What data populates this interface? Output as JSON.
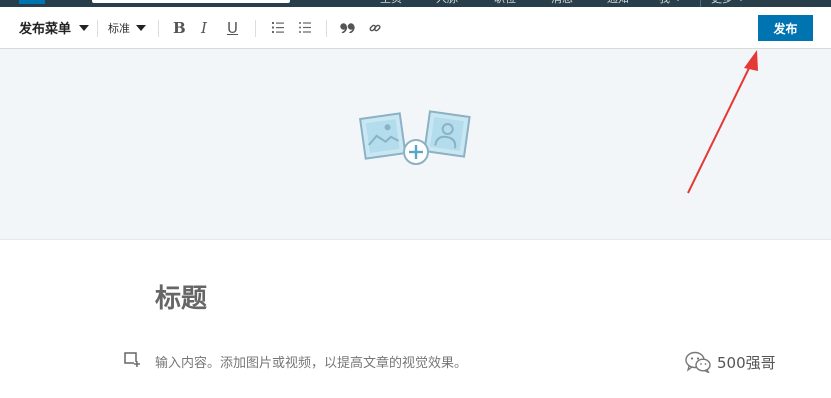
{
  "topnav": {
    "items": [
      "主页",
      "人脉",
      "职位",
      "消息",
      "通知",
      "我",
      "更多"
    ]
  },
  "toolbar": {
    "publish_menu_label": "发布菜单",
    "style_select_value": "标准",
    "bold_label": "B",
    "italic_label": "I",
    "underline_label": "U",
    "icons": [
      "ordered-list-icon",
      "bulleted-list-icon",
      "quote-icon",
      "link-icon"
    ],
    "publish_label": "发布"
  },
  "cover": {
    "icon": "add-cover-image-icon"
  },
  "editor": {
    "title_placeholder": "标题",
    "body_placeholder": "输入内容。添加图片或视频，以提高文章的视觉效果。",
    "add_media_icon": "add-media-icon"
  },
  "watermark": {
    "text": "500强哥",
    "icon": "wechat-icon"
  },
  "annotation": {
    "color": "#e53935"
  },
  "colors": {
    "primary": "#0073b1",
    "nav_bg": "#283e4a",
    "cover_bg": "#f3f6f8"
  }
}
